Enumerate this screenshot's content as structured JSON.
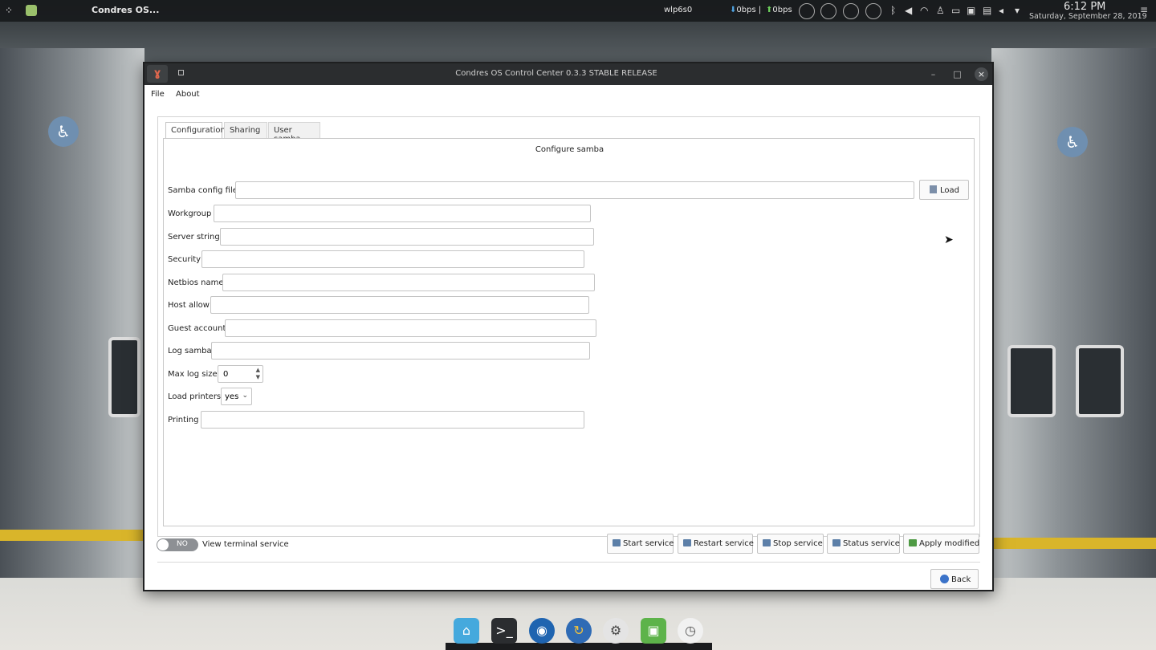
{
  "topbar": {
    "launcher_icon": "dots-launcher-icon",
    "active_app": "Condres OS...",
    "net_iface": "wlp6s0",
    "net_down": "0bps",
    "net_separator": "|",
    "net_up": "0bps",
    "time": "6:12 PM",
    "date": "Saturday, September 28, 2019"
  },
  "window": {
    "title": "Condres OS Control Center 0.3.3 STABLE RELEASE",
    "menu": [
      "File",
      "About"
    ],
    "tabs": [
      "Configuration",
      "Sharing",
      "User samba"
    ],
    "active_tab": "Configuration",
    "panel_header": "Configure samba",
    "fields": {
      "samba_config_file": "Samba config file",
      "workgroup": "Workgroup",
      "server_string": "Server string",
      "security": "Security",
      "netbios_name": "Netbios name",
      "host_allow": "Host allow",
      "guest_account": "Guest account",
      "log_samba": "Log samba",
      "max_log_size": "Max log size",
      "load_printers": "Load printers",
      "printing": "Printing"
    },
    "values": {
      "max_log_size": "0",
      "load_printers": "yes"
    },
    "load_button": "Load",
    "toggle": {
      "state": "NO",
      "label": "View terminal service"
    },
    "service_buttons": {
      "start": "Start service",
      "restart": "Restart service",
      "stop": "Stop service",
      "status": "Status service",
      "apply": "Apply modified"
    },
    "back_button": "Back"
  },
  "colors": {
    "accent": "#3b73c9",
    "titlebar": "#2b2d2f",
    "panel_bg": "#181a1c"
  }
}
